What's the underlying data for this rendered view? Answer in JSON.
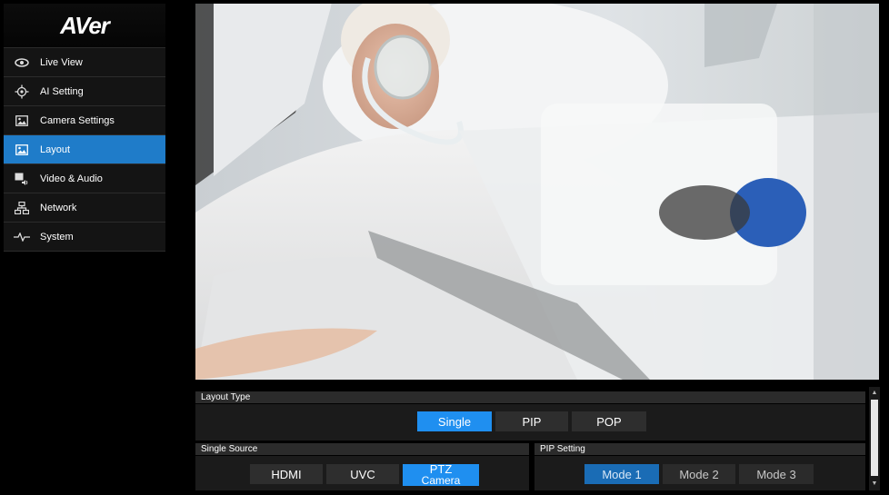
{
  "brand": {
    "logo": "AVer"
  },
  "sidebar": {
    "items": [
      {
        "label": "Live View",
        "icon": "eye-icon"
      },
      {
        "label": "AI Setting",
        "icon": "target-icon"
      },
      {
        "label": "Camera Settings",
        "icon": "image-icon"
      },
      {
        "label": "Layout",
        "icon": "layout-icon",
        "active": true
      },
      {
        "label": "Video & Audio",
        "icon": "video-audio-icon"
      },
      {
        "label": "Network",
        "icon": "network-icon"
      },
      {
        "label": "System",
        "icon": "pulse-icon"
      }
    ]
  },
  "layout_type": {
    "title": "Layout Type",
    "options": [
      "Single",
      "PIP",
      "POP"
    ],
    "selected": "Single"
  },
  "single_source": {
    "title": "Single Source",
    "options": [
      "HDMI",
      "UVC",
      "PTZ"
    ],
    "selected": "PTZ",
    "selected_sub": "Camera"
  },
  "pip_setting": {
    "title": "PIP Setting",
    "options": [
      "Mode 1",
      "Mode 2",
      "Mode 3"
    ],
    "selected": "Mode 1"
  },
  "colors": {
    "accent": "#1f8ff0",
    "sidebar_active": "#1f7cc9",
    "background": "#000000"
  }
}
